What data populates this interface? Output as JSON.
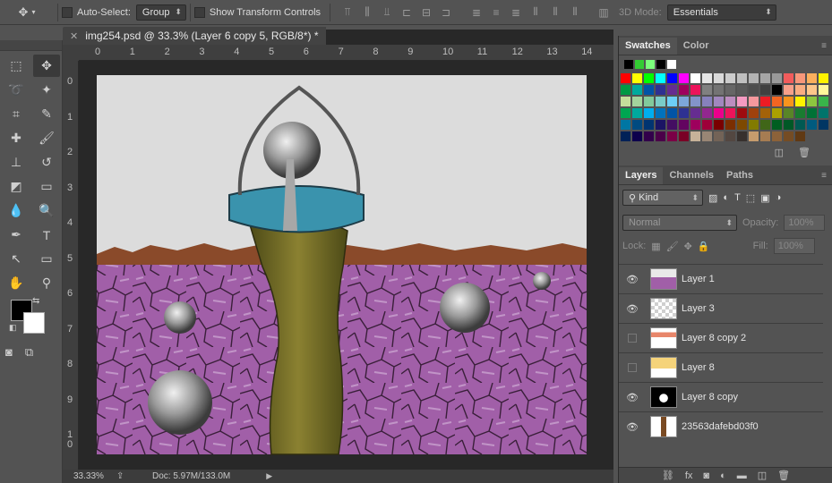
{
  "options_bar": {
    "auto_select_label": "Auto-Select:",
    "auto_select_value": "Group",
    "show_transform_label": "Show Transform Controls",
    "mode_3d_label": "3D Mode:",
    "workspace": "Essentials"
  },
  "document": {
    "tab_title": "img254.psd @ 33.3% (Layer 6 copy 5, RGB/8*) *",
    "zoom": "33.33%",
    "doc_size": "Doc: 5.97M/133.0M",
    "ruler_h": [
      "0",
      "1",
      "2",
      "3",
      "4",
      "5",
      "6",
      "7",
      "8",
      "9",
      "10",
      "11",
      "12",
      "13",
      "14"
    ],
    "ruler_v": [
      "0",
      "1",
      "2",
      "3",
      "4",
      "5",
      "6",
      "7",
      "8",
      "9",
      "1\n0"
    ]
  },
  "swatches_panel": {
    "tabs": [
      "Swatches",
      "Color"
    ],
    "recent": [
      "#000000",
      "#33cc33",
      "#7cff7c",
      "#000000",
      "#ffffff"
    ],
    "colors": [
      "#ff0000",
      "#ffff00",
      "#00ff00",
      "#00ffff",
      "#0000ff",
      "#ff00ff",
      "#ffffff",
      "#e6e6e6",
      "#d9d9d9",
      "#cccccc",
      "#bfbfbf",
      "#b3b3b3",
      "#a6a6a6",
      "#999999",
      "#f25c5c",
      "#f7977a",
      "#fbaf5d",
      "#fff200",
      "#009944",
      "#00a99d",
      "#0054a6",
      "#2e3192",
      "#662d91",
      "#9e005d",
      "#ed145b",
      "#808080",
      "#737373",
      "#666666",
      "#595959",
      "#4d4d4d",
      "#404040",
      "#000000",
      "#f7a08a",
      "#f9ad81",
      "#fdc68a",
      "#fff79a",
      "#c4df9b",
      "#a3d39c",
      "#82ca9c",
      "#7accc8",
      "#6dcff6",
      "#7da7d9",
      "#8393ca",
      "#8781bd",
      "#a187be",
      "#bc8dbf",
      "#f49ac2",
      "#f6989d",
      "#ed1c24",
      "#f26522",
      "#f7941d",
      "#fff200",
      "#8dc63f",
      "#39b54a",
      "#00a651",
      "#00a99d",
      "#00aeef",
      "#0072bc",
      "#0054a6",
      "#2e3192",
      "#662d91",
      "#92278f",
      "#ec008c",
      "#ed145b",
      "#9e0b0f",
      "#a0410d",
      "#a36209",
      "#aba000",
      "#598527",
      "#197b30",
      "#007236",
      "#00746b",
      "#0076a3",
      "#004a80",
      "#003471",
      "#1b1464",
      "#440e62",
      "#630460",
      "#9e005d",
      "#9e0039",
      "#790000",
      "#7b2e00",
      "#7d4900",
      "#827b00",
      "#406618",
      "#005e20",
      "#005826",
      "#005952",
      "#005b7f",
      "#003663",
      "#002157",
      "#0d004c",
      "#32004b",
      "#4b0049",
      "#7b0046",
      "#7a0026",
      "#c7b299",
      "#998675",
      "#736357",
      "#534741",
      "#37302d",
      "#c69c6d",
      "#a67c52",
      "#8c6239",
      "#754c24",
      "#603913"
    ],
    "footer_icons": [
      "new-swatch-icon",
      "trash-icon"
    ]
  },
  "layers_panel": {
    "tabs": [
      "Layers",
      "Channels",
      "Paths"
    ],
    "filter_kind": "Kind",
    "blend_mode": "Normal",
    "opacity_label": "Opacity:",
    "opacity_value": "100%",
    "lock_label": "Lock:",
    "fill_label": "Fill:",
    "fill_value": "100%",
    "layers": [
      {
        "name": "Layer 1",
        "visible": true
      },
      {
        "name": "Layer 3",
        "visible": true
      },
      {
        "name": "Layer 8 copy 2",
        "visible": false
      },
      {
        "name": "Layer 8",
        "visible": false
      },
      {
        "name": "Layer 8 copy",
        "visible": true
      },
      {
        "name": "23563dafebd03f0",
        "visible": true
      }
    ]
  }
}
